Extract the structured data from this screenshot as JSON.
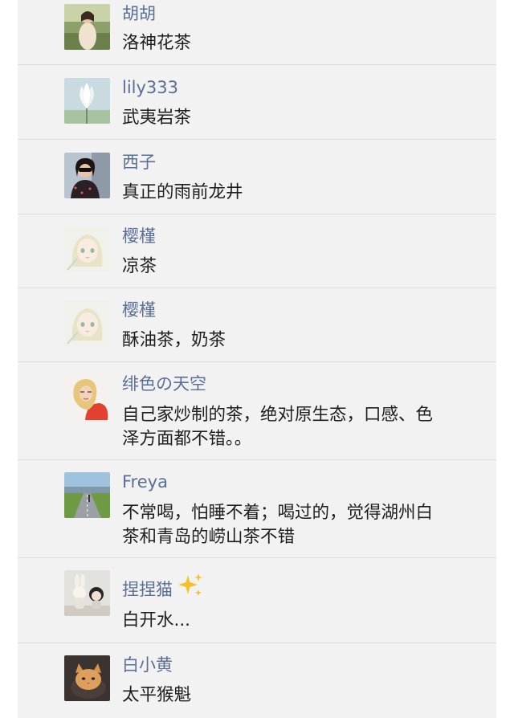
{
  "comments": [
    {
      "name": "胡胡",
      "text": [
        "洛神花茶"
      ],
      "avatar_icon": "avatar-woman-dress-photo"
    },
    {
      "name": "lily333",
      "text": [
        "武夷岩茶"
      ],
      "avatar_icon": "avatar-white-flower-photo"
    },
    {
      "name": "西子",
      "text": [
        "真正的雨前龙井"
      ],
      "avatar_icon": "avatar-woman-sunglasses-photo"
    },
    {
      "name": "樱槿",
      "text": [
        "凉茶"
      ],
      "avatar_icon": "avatar-anime-girl"
    },
    {
      "name": "樱槿",
      "text": [
        "酥油茶，奶茶"
      ],
      "avatar_icon": "avatar-anime-girl"
    },
    {
      "name": "绯色の天空",
      "text": [
        "自己家炒制的茶，绝对原生态，口感、色",
        "泽方面都不错。。"
      ],
      "avatar_icon": "avatar-blonde-woman-photo"
    },
    {
      "name": "Freya",
      "text": [
        "不常喝，怕睡不着；喝过的，觉得湖州白",
        "茶和青岛的崂山茶不错"
      ],
      "avatar_icon": "avatar-road-landscape-photo"
    },
    {
      "name": "捏捏猫",
      "text": [
        "白开水..."
      ],
      "avatar_icon": "avatar-toy-figures-photo",
      "name_emoji": "sparkles-icon"
    },
    {
      "name": "白小黄",
      "text": [
        "太平猴魁"
      ],
      "avatar_icon": "avatar-orange-cat-photo"
    }
  ],
  "colors": {
    "background": "#f2f2f2",
    "name": "#5b6e95",
    "text": "#1e1e1e",
    "divider": "#dedede"
  }
}
